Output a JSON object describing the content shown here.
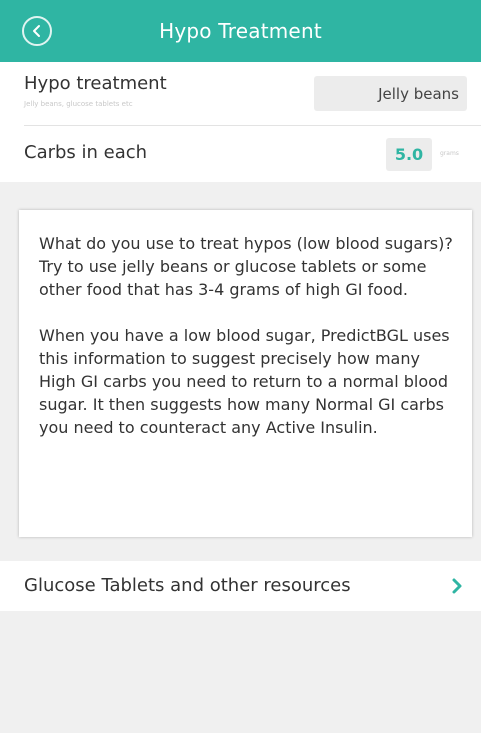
{
  "header": {
    "title": "Hypo Treatment",
    "back_icon": "chevron-left-icon",
    "color": "#2fb5a3"
  },
  "form": {
    "treatment_label": "Hypo treatment",
    "treatment_sublabel": "Jelly beans, glucose tablets etc",
    "treatment_value": "Jelly beans",
    "carbs_label": "Carbs in each",
    "carbs_value": "5.0",
    "carbs_unit": "grams"
  },
  "info": {
    "paragraph1": "What do you use to treat hypos (low blood sugars)? Try to use jelly beans or glucose tablets or some other food that has 3-4 grams of high GI food.",
    "paragraph2": "When you have a low blood sugar, PredictBGL uses this information to suggest precisely how many High GI carbs you need to return to a normal blood sugar. It then suggests how many Normal GI carbs you need to counteract any Active Insulin."
  },
  "resources": {
    "label": "Glucose Tablets and other resources",
    "icon": "chevron-right-icon"
  }
}
